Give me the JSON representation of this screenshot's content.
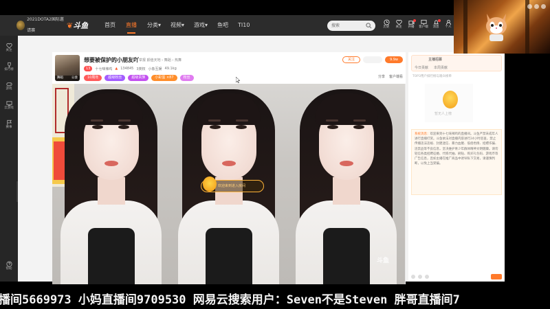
{
  "nav": {
    "logo_text": "2021DOTA2国际邀请赛",
    "brand": "斗鱼",
    "items": [
      "首页",
      "直播",
      "分类",
      "视频",
      "游戏",
      "鱼吧",
      "TI10"
    ],
    "active_index": 1,
    "search_placeholder": "搜索",
    "tools": [
      "历史",
      "关注",
      "开播",
      "客户端",
      "消息",
      "个人"
    ]
  },
  "sidebar": {
    "items": [
      "关注",
      "排行榜",
      "游戏",
      "云游戏",
      "赛事",
      "帮助"
    ]
  },
  "room": {
    "title": "想要被保护的小朋友吖",
    "tags": "举报  颜值天地 › 舞蹈 › 热舞",
    "avatar_caption_left": "舞蹈",
    "avatar_caption_right": "公会",
    "level": "13",
    "host_name": "十七味辣鸡",
    "heat": "134845",
    "ranks": "3类权",
    "zone": "小象互娱",
    "weight": "49.1kg",
    "badges": [
      "10周年",
      "超级粉丝",
      "超级贵族",
      "小彩蛋 ×87",
      "粉丝"
    ],
    "follow_label": "关注",
    "heart_label": "9.9w",
    "share_label": "分享",
    "client_label": "客户端看"
  },
  "player": {
    "enter_message": "欢迎来到进入房间",
    "watermark": "斗鱼"
  },
  "chat": {
    "board_title": "主播招募",
    "board_tabs": [
      "今日贡献",
      "本周贡献"
    ],
    "rank_hint": "TOP3用户排行榜与观众榜单",
    "mascot_caption": "暂无人上榜",
    "notice_head": "系统消息：",
    "notice_body": "欢迎来到十七味辣鸡的直播间。斗鱼严禁未成年人进行直播打赏。斗鱼依法对直播内容进行24小时巡查，禁止传播违法违规、封建迷信、暴力血腥、低俗色情、招嫖诈骗、违禁品等不良信息，坚决维护青少年群体精神文明健康。请勿轻信各类招聘征婚、代练代抽、刷钻、购买礼包码、游戏币等广告信息，且如主播在推广商品中诱导私下交易，请谨慎判断，以免上当受骗。"
  },
  "ticker": {
    "text": "播间5669973 小妈直播间9709530 网易云搜索用户：Seven不是Steven 胖哥直播间7"
  },
  "colors": {
    "accent": "#ff7a2b",
    "nav_bg": "#2c2c2c",
    "sidebar_bg": "#262626"
  }
}
